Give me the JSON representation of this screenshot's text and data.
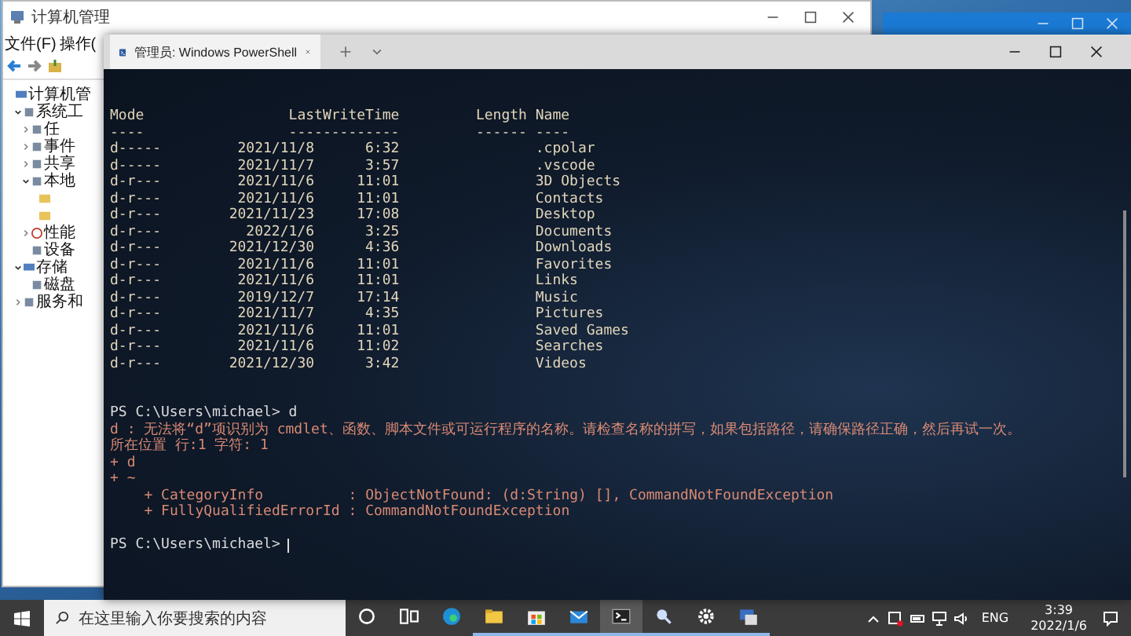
{
  "background_window": {
    "title": "计算机管理",
    "menu": [
      "文件(F)",
      "操作("
    ],
    "tree": [
      {
        "label": "计算机管",
        "kind": "computer",
        "children": [
          {
            "label": "系统工",
            "kind": "tool",
            "expanded": true,
            "children": [
              {
                "label": "任",
                "kind": "clock",
                "expanded": false
              },
              {
                "label": "事件",
                "kind": "log",
                "expanded": false
              },
              {
                "label": "共享",
                "kind": "share",
                "expanded": false
              },
              {
                "label": "本地",
                "kind": "users",
                "expanded": true,
                "children": [
                  {
                    "kind": "folder"
                  },
                  {
                    "kind": "folder"
                  }
                ]
              },
              {
                "label": "性能",
                "kind": "perf",
                "expanded": false
              },
              {
                "label": "设备",
                "kind": "device"
              }
            ]
          },
          {
            "label": "存储",
            "kind": "storage",
            "expanded": true,
            "children": [
              {
                "label": "磁盘",
                "kind": "disk"
              }
            ]
          },
          {
            "label": "服务和",
            "kind": "service",
            "expanded": false
          }
        ]
      }
    ]
  },
  "terminal": {
    "tab_title": "管理员: Windows PowerShell",
    "header": {
      "mode": "Mode",
      "last_write_time": "LastWriteTime",
      "length": "Length",
      "name": "Name"
    },
    "underline": {
      "mode": "----",
      "last_write_time": "-------------",
      "length": "------",
      "name": "----"
    },
    "rows": [
      {
        "mode": "d-----",
        "date": "2021/11/8",
        "time": "6:32",
        "name": ".cpolar"
      },
      {
        "mode": "d-----",
        "date": "2021/11/7",
        "time": "3:57",
        "name": ".vscode"
      },
      {
        "mode": "d-r---",
        "date": "2021/11/6",
        "time": "11:01",
        "name": "3D Objects"
      },
      {
        "mode": "d-r---",
        "date": "2021/11/6",
        "time": "11:01",
        "name": "Contacts"
      },
      {
        "mode": "d-r---",
        "date": "2021/11/23",
        "time": "17:08",
        "name": "Desktop"
      },
      {
        "mode": "d-r---",
        "date": "2022/1/6",
        "time": "3:25",
        "name": "Documents"
      },
      {
        "mode": "d-r---",
        "date": "2021/12/30",
        "time": "4:36",
        "name": "Downloads"
      },
      {
        "mode": "d-r---",
        "date": "2021/11/6",
        "time": "11:01",
        "name": "Favorites"
      },
      {
        "mode": "d-r---",
        "date": "2021/11/6",
        "time": "11:01",
        "name": "Links"
      },
      {
        "mode": "d-r---",
        "date": "2019/12/7",
        "time": "17:14",
        "name": "Music"
      },
      {
        "mode": "d-r---",
        "date": "2021/11/7",
        "time": "4:35",
        "name": "Pictures"
      },
      {
        "mode": "d-r---",
        "date": "2021/11/6",
        "time": "11:01",
        "name": "Saved Games"
      },
      {
        "mode": "d-r---",
        "date": "2021/11/6",
        "time": "11:02",
        "name": "Searches"
      },
      {
        "mode": "d-r---",
        "date": "2021/12/30",
        "time": "3:42",
        "name": "Videos"
      }
    ],
    "command": "PS C:\\Users\\michael> d",
    "error_lines": [
      "d : 无法将“d”项识别为 cmdlet、函数、脚本文件或可运行程序的名称。请检查名称的拼写，如果包括路径，请确保路径正确，然后再试一次。",
      "所在位置 行:1 字符: 1",
      "+ d",
      "+ ~",
      "    + CategoryInfo          : ObjectNotFound: (d:String) [], CommandNotFoundException",
      "    + FullyQualifiedErrorId : CommandNotFoundException"
    ],
    "prompt": "PS C:\\Users\\michael>"
  },
  "taskbar": {
    "search_placeholder": "在这里输入你要搜索的内容",
    "apps": [
      {
        "kind": "cortana",
        "running": false,
        "selected": false
      },
      {
        "kind": "task-view",
        "running": false,
        "selected": false
      },
      {
        "kind": "edge",
        "running": false,
        "selected": false
      },
      {
        "kind": "explorer",
        "running": true,
        "selected": false
      },
      {
        "kind": "store",
        "running": true,
        "selected": false
      },
      {
        "kind": "mail",
        "running": true,
        "selected": false
      },
      {
        "kind": "terminal",
        "running": true,
        "selected": true
      },
      {
        "kind": "search",
        "running": true,
        "selected": false
      },
      {
        "kind": "settings",
        "running": true,
        "selected": false
      },
      {
        "kind": "manager",
        "running": true,
        "selected": false
      }
    ],
    "language": "ENG",
    "time": "3:39",
    "date": "2022/1/6"
  }
}
